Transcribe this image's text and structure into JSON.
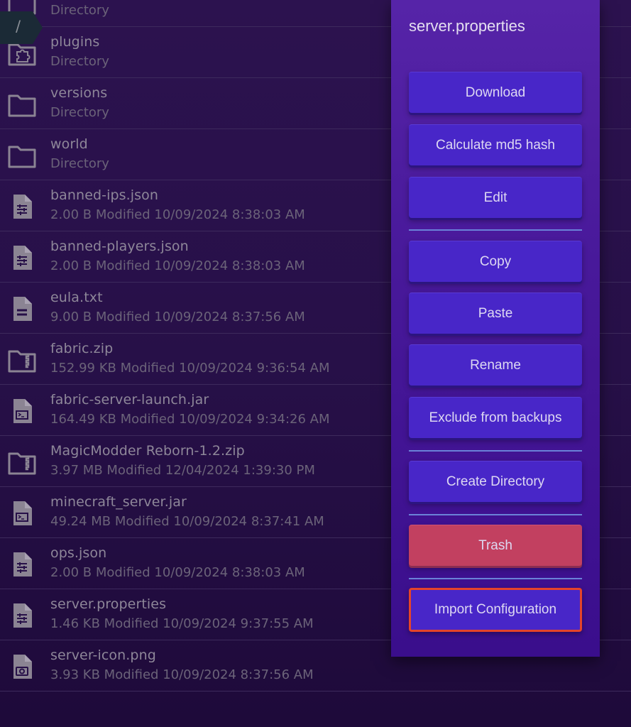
{
  "breadcrumb": {
    "path": "/"
  },
  "files": [
    {
      "name": "",
      "meta": "Directory",
      "icon": "folder-icon"
    },
    {
      "name": "plugins",
      "meta": "Directory",
      "icon": "folder-plugin-icon"
    },
    {
      "name": "versions",
      "meta": "Directory",
      "icon": "folder-icon"
    },
    {
      "name": "world",
      "meta": "Directory",
      "icon": "folder-icon"
    },
    {
      "name": "banned-ips.json",
      "meta": "2.00 B Modified 10/09/2024 8:38:03 AM",
      "icon": "config-file-icon"
    },
    {
      "name": "banned-players.json",
      "meta": "2.00 B Modified 10/09/2024 8:38:03 AM",
      "icon": "config-file-icon"
    },
    {
      "name": "eula.txt",
      "meta": "9.00 B Modified 10/09/2024 8:37:56 AM",
      "icon": "text-file-icon"
    },
    {
      "name": "fabric.zip",
      "meta": "152.99 KB Modified 10/09/2024 9:36:54 AM",
      "icon": "archive-icon"
    },
    {
      "name": "fabric-server-launch.jar",
      "meta": "164.49 KB Modified 10/09/2024 9:34:26 AM",
      "icon": "executable-file-icon"
    },
    {
      "name": "MagicModder Reborn-1.2.zip",
      "meta": "3.97 MB Modified 12/04/2024 1:39:30 PM",
      "icon": "archive-icon"
    },
    {
      "name": "minecraft_server.jar",
      "meta": "49.24 MB Modified 10/09/2024 8:37:41 AM",
      "icon": "executable-file-icon"
    },
    {
      "name": "ops.json",
      "meta": "2.00 B Modified 10/09/2024 8:38:03 AM",
      "icon": "config-file-icon"
    },
    {
      "name": "server.properties",
      "meta": "1.46 KB Modified 10/09/2024 9:37:55 AM",
      "icon": "config-file-icon"
    },
    {
      "name": "server-icon.png",
      "meta": "3.93 KB Modified 10/09/2024 8:37:56 AM",
      "icon": "image-file-icon"
    }
  ],
  "context_menu": {
    "title": "server.properties",
    "buttons": {
      "download": "Download",
      "md5": "Calculate md5 hash",
      "edit": "Edit",
      "copy": "Copy",
      "paste": "Paste",
      "rename": "Rename",
      "exclude": "Exclude from backups",
      "create_directory": "Create Directory",
      "trash": "Trash",
      "import_configuration": "Import Configuration"
    }
  },
  "colors": {
    "primary_button": "#4826c8",
    "danger_button": "#c24060",
    "highlight_outline": "#e5442a"
  }
}
